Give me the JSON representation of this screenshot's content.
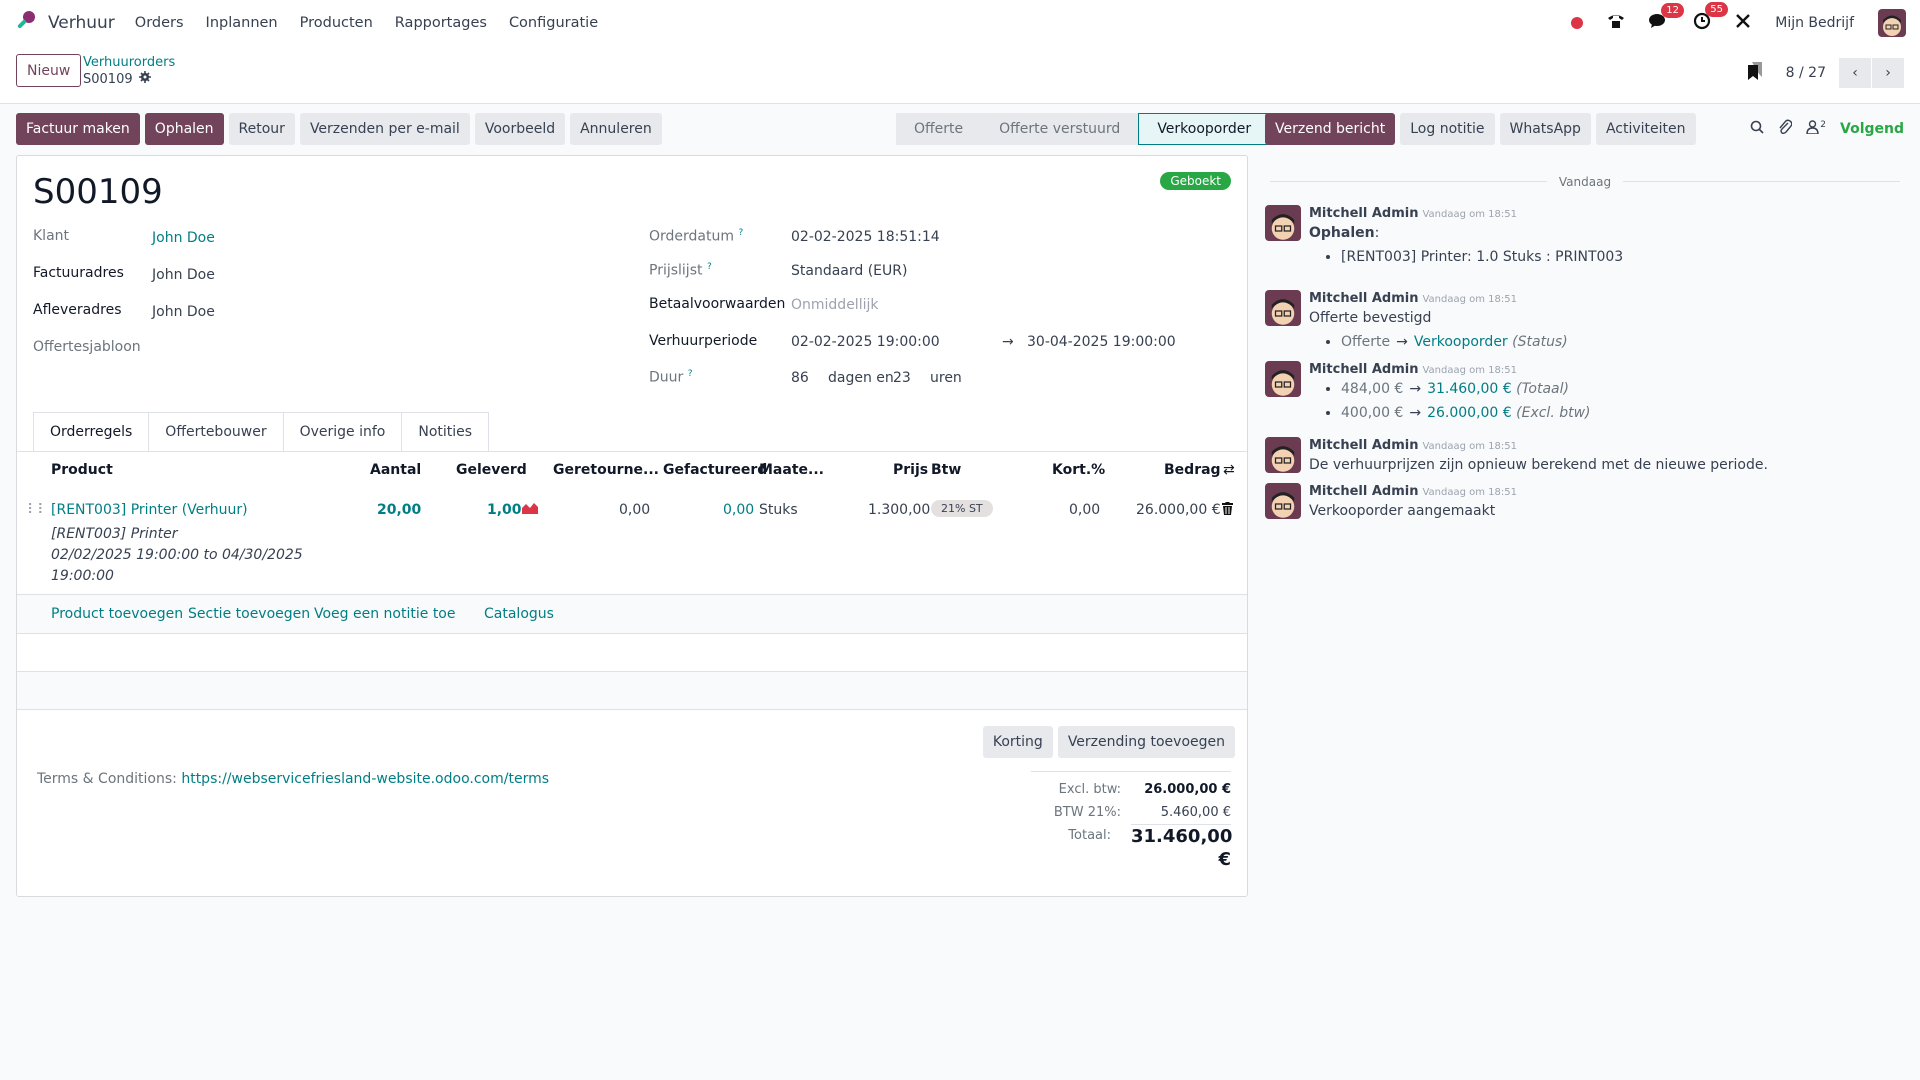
{
  "navbar": {
    "app_name": "Verhuur",
    "menu": [
      "Orders",
      "Inplannen",
      "Producten",
      "Rapportages",
      "Configuratie"
    ],
    "messages_count": "12",
    "activities_count": "55",
    "company": "Mijn Bedrijf"
  },
  "control_panel": {
    "new_label": "Nieuw",
    "breadcrumb_parent": "Verhuurorders",
    "breadcrumb_current": "S00109",
    "pager_value": "8 / 27"
  },
  "actions": {
    "buttons": [
      "Factuur maken",
      "Ophalen",
      "Retour",
      "Verzenden per e-mail",
      "Voorbeeld",
      "Annuleren"
    ],
    "status_steps": [
      "Offerte",
      "Offerte verstuurd",
      "Verkooporder"
    ],
    "active_status": "Verkooporder"
  },
  "form": {
    "title": "S00109",
    "ribbon": "Geboekt",
    "left_fields": [
      {
        "label": "Klant",
        "value": "John Doe"
      },
      {
        "label": "Factuuradres",
        "value": "John Doe"
      },
      {
        "label": "Afleveradres",
        "value": "John Doe"
      },
      {
        "label": "Offertesjabloon",
        "value": ""
      }
    ],
    "right_fields": {
      "orderdatum_label": "Orderdatum",
      "orderdatum": "02-02-2025 18:51:14",
      "prijslijst_label": "Prijslijst",
      "prijslijst": "Standaard (EUR)",
      "betaal_label": "Betaalvoorwaarden",
      "betaal_placeholder": "Onmiddellijk",
      "periode_label": "Verhuurperiode",
      "periode_start": "02-02-2025 19:00:00",
      "periode_end": "30-04-2025 19:00:00",
      "duur_label": "Duur",
      "duur_days": "86",
      "duur_mid": "dagen en",
      "duur_hours": "23",
      "duur_unit": "uren",
      "help_mark": "?"
    },
    "tabs": [
      "Orderregels",
      "Offertebouwer",
      "Overige info",
      "Notities"
    ],
    "columns": [
      "Product",
      "Aantal",
      "Geleverd",
      "Geretourne...",
      "Gefactureerd",
      "Maate...",
      "Prijs",
      "Btw",
      "Kort.%",
      "Bedrag"
    ],
    "lines": [
      {
        "product": "[RENT003] Printer (Verhuur)",
        "description": [
          "[RENT003] Printer",
          "02/02/2025 19:00:00 to 04/30/2025",
          "19:00:00"
        ],
        "quantity": "20,00",
        "delivered": "1,00",
        "returned": "0,00",
        "invoiced": "0,00",
        "uom": "Stuks",
        "price": "1.300,00",
        "tax": "21% ST",
        "discount": "0,00",
        "subtotal": "26.000,00 €"
      }
    ],
    "add_links": [
      "Product toevoegen",
      "Sectie toevoegen",
      "Voeg een notitie toe",
      "Catalogus"
    ],
    "terms_label": "Terms & Conditions:",
    "terms_link": "https://webservicefriesland-website.odoo.com/terms",
    "total_buttons": [
      "Korting",
      "Verzending toevoegen"
    ],
    "totals": [
      {
        "label": "Excl. btw:",
        "value": "26.000,00 €"
      },
      {
        "label": "BTW 21%:",
        "value": "5.460,00 €"
      },
      {
        "label": "Totaal:",
        "value": "31.460,00 €"
      }
    ]
  },
  "chatter": {
    "buttons": [
      "Verzend bericht",
      "Log notitie",
      "WhatsApp",
      "Activiteiten"
    ],
    "followers_count": "2",
    "follow_label": "Volgend",
    "date_separator": "Vandaag",
    "messages": [
      {
        "author": "Mitchell Admin",
        "time": "Vandaag om 18:51",
        "title": "Ophalen",
        "item": "[RENT003] Printer: 1.0 Stuks : PRINT003"
      },
      {
        "author": "Mitchell Admin",
        "time": "Vandaag om 18:51",
        "text": "Offerte bevestigd",
        "old": "Offerte",
        "new": "Verkooporder",
        "field": "(Status)"
      },
      {
        "author": "Mitchell Admin",
        "time": "Vandaag om 18:51",
        "changes": [
          {
            "old": "484,00 €",
            "new": "31.460,00 €",
            "field": "(Totaal)"
          },
          {
            "old": "400,00 €",
            "new": "26.000,00 €",
            "field": "(Excl. btw)"
          }
        ]
      },
      {
        "author": "Mitchell Admin",
        "time": "Vandaag om 18:51",
        "text": "De verhuurprijzen zijn opnieuw berekend met de nieuwe periode."
      },
      {
        "author": "Mitchell Admin",
        "time": "Vandaag om 18:51",
        "text": "Verkooporder aangemaakt"
      }
    ]
  }
}
